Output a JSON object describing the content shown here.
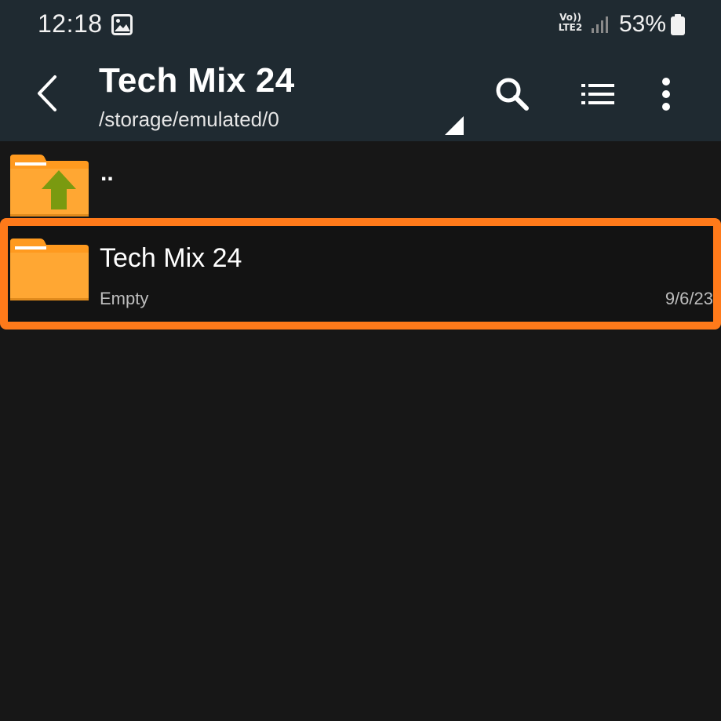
{
  "status_bar": {
    "time": "12:18",
    "notification_icon": "gallery-icon",
    "network_top": "Vo))",
    "network_bottom": "LTE2",
    "battery_percent": "53%"
  },
  "toolbar": {
    "title": "Tech Mix 24",
    "path": "/storage/emulated/0",
    "back_icon": "back-arrow-icon",
    "search_icon": "search-icon",
    "list_icon": "list-view-icon",
    "more_icon": "more-vert-icon"
  },
  "file_list": {
    "parent_row": {
      "label": "..",
      "icon": "folder-up-icon"
    },
    "items": [
      {
        "name": "Tech Mix 24",
        "meta": "Empty",
        "date": "9/6/23",
        "icon": "folder-icon",
        "selected": true
      }
    ]
  },
  "colors": {
    "toolbar_bg": "#1f2a31",
    "list_bg": "#171717",
    "folder_orange": "#ffa733",
    "folder_tab": "#ff9a1f",
    "selection_border": "#ff7a1a",
    "up_arrow_green": "#7a9a10"
  }
}
